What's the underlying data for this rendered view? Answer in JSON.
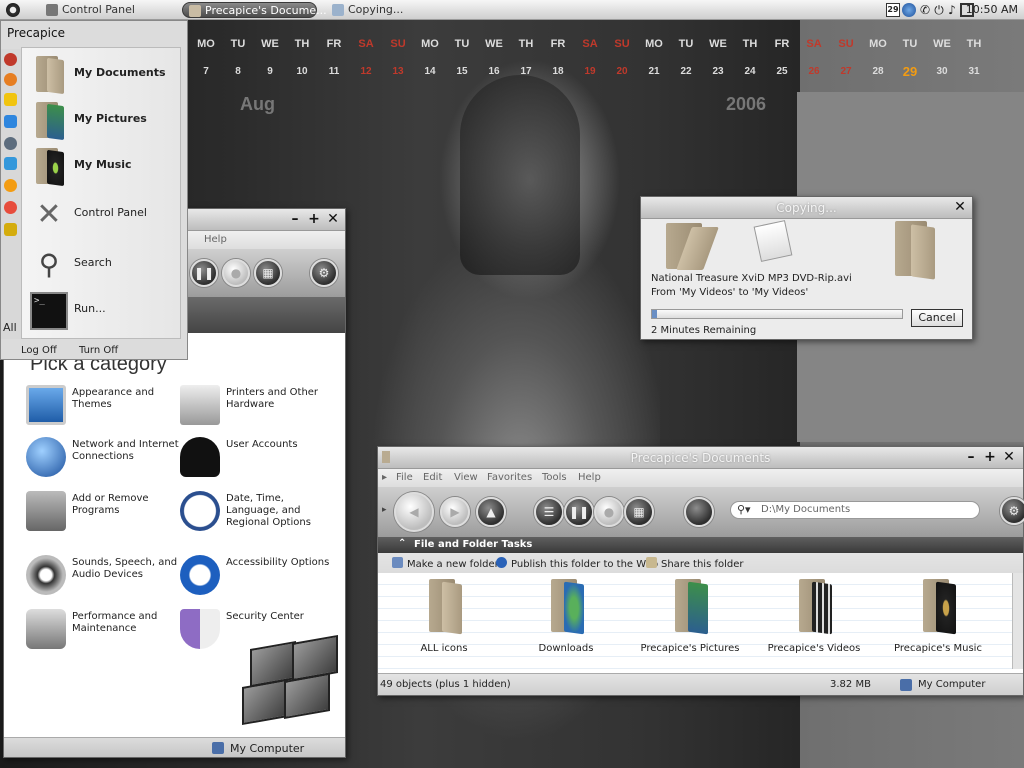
{
  "taskbar": {
    "start_label": "",
    "tasks": [
      {
        "label": "Control Panel",
        "active": false
      },
      {
        "label": "Precapice's Docume...",
        "active": true
      },
      {
        "label": "Copying...",
        "active": false
      }
    ],
    "tray_date": "29",
    "clock": "10:50 AM",
    "tray_icons": [
      "calendar-icon",
      "search-icon",
      "phone-icon",
      "network-icon",
      "volume-icon",
      "monitor-icon"
    ]
  },
  "calendar": {
    "days": [
      "MO",
      "TU",
      "WE",
      "TH",
      "FR",
      "SA",
      "SU",
      "MO",
      "TU",
      "WE",
      "TH",
      "FR",
      "SA",
      "SU",
      "MO",
      "TU",
      "WE",
      "TH",
      "FR",
      "SA",
      "SU",
      "MO",
      "TU",
      "WE",
      "TH"
    ],
    "dates": [
      "7",
      "8",
      "9",
      "10",
      "11",
      "12",
      "13",
      "14",
      "15",
      "16",
      "17",
      "18",
      "19",
      "20",
      "21",
      "22",
      "23",
      "24",
      "25",
      "26",
      "27",
      "28",
      "29",
      "30",
      "31"
    ],
    "weekend_indexes": [
      5,
      6,
      12,
      13,
      19,
      20
    ],
    "today_index": 22,
    "month": "Aug",
    "year": "2006",
    "colors": {
      "weekend": "#c0392b",
      "today": "#f39c12"
    }
  },
  "start_menu": {
    "user": "Precapice",
    "all_programs": "All",
    "items": [
      {
        "label": "My Documents",
        "icon": "my-documents-folder-icon"
      },
      {
        "label": "My Pictures",
        "icon": "my-pictures-folder-icon"
      },
      {
        "label": "My Music",
        "icon": "my-music-folder-icon"
      },
      {
        "label": "Control Panel",
        "icon": "control-panel-tools-icon"
      },
      {
        "label": "Search",
        "icon": "search-magnifier-icon"
      },
      {
        "label": "Run...",
        "icon": "run-terminal-icon"
      }
    ],
    "log_off": "Log Off",
    "turn_off": "Turn Off"
  },
  "control_panel": {
    "menu_help": "Help",
    "heading": "Pick a category",
    "categories": [
      {
        "label": "Appearance and Themes",
        "icon": "monitor-icon"
      },
      {
        "label": "Printers and Other Hardware",
        "icon": "printer-icon"
      },
      {
        "label": "Network and Internet Connections",
        "icon": "globe-icon"
      },
      {
        "label": "User Accounts",
        "icon": "user-silhouette-icon"
      },
      {
        "label": "Add or Remove Programs",
        "icon": "install-box-icon"
      },
      {
        "label": "Date, Time, Language, and Regional Options",
        "icon": "clock-calendar-icon"
      },
      {
        "label": "Sounds, Speech, and Audio Devices",
        "icon": "speakers-icon"
      },
      {
        "label": "Accessibility Options",
        "icon": "accessibility-icon"
      },
      {
        "label": "Performance and Maintenance",
        "icon": "stethoscope-icon"
      },
      {
        "label": "Security Center",
        "icon": "shield-icon"
      }
    ],
    "status": "My Computer"
  },
  "copy_dialog": {
    "title": "Copying...",
    "file_name": "National Treasure XviD MP3 DVD-Rip.avi",
    "from_to": "From 'My Videos' to 'My Videos'",
    "remaining": "2 Minutes Remaining",
    "cancel": "Cancel",
    "progress": 0.02
  },
  "documents": {
    "title": "Precapice's Documents",
    "menu": [
      "File",
      "Edit",
      "View",
      "Favorites",
      "Tools",
      "Help"
    ],
    "address": "D:\\My Documents",
    "tasks_header": "File and Folder Tasks",
    "tasks": [
      {
        "label": "Make a new folder",
        "icon": "new-folder-icon"
      },
      {
        "label": "Publish this folder to the Web",
        "icon": "web-publish-icon"
      },
      {
        "label": "Share this folder",
        "icon": "share-folder-icon"
      }
    ],
    "files": [
      {
        "label": "ALL icons",
        "icon": "all-icons-folder-icon"
      },
      {
        "label": "Downloads",
        "icon": "downloads-folder-icon"
      },
      {
        "label": "Precapice's Pictures",
        "icon": "pictures-folder-icon"
      },
      {
        "label": "Precapice's Videos",
        "icon": "videos-folder-icon"
      },
      {
        "label": "Precapice's Music",
        "icon": "music-folder-icon"
      }
    ],
    "status_objects": "49 objects (plus 1 hidden)",
    "status_size": "3.82 MB",
    "status_location": "My Computer"
  }
}
